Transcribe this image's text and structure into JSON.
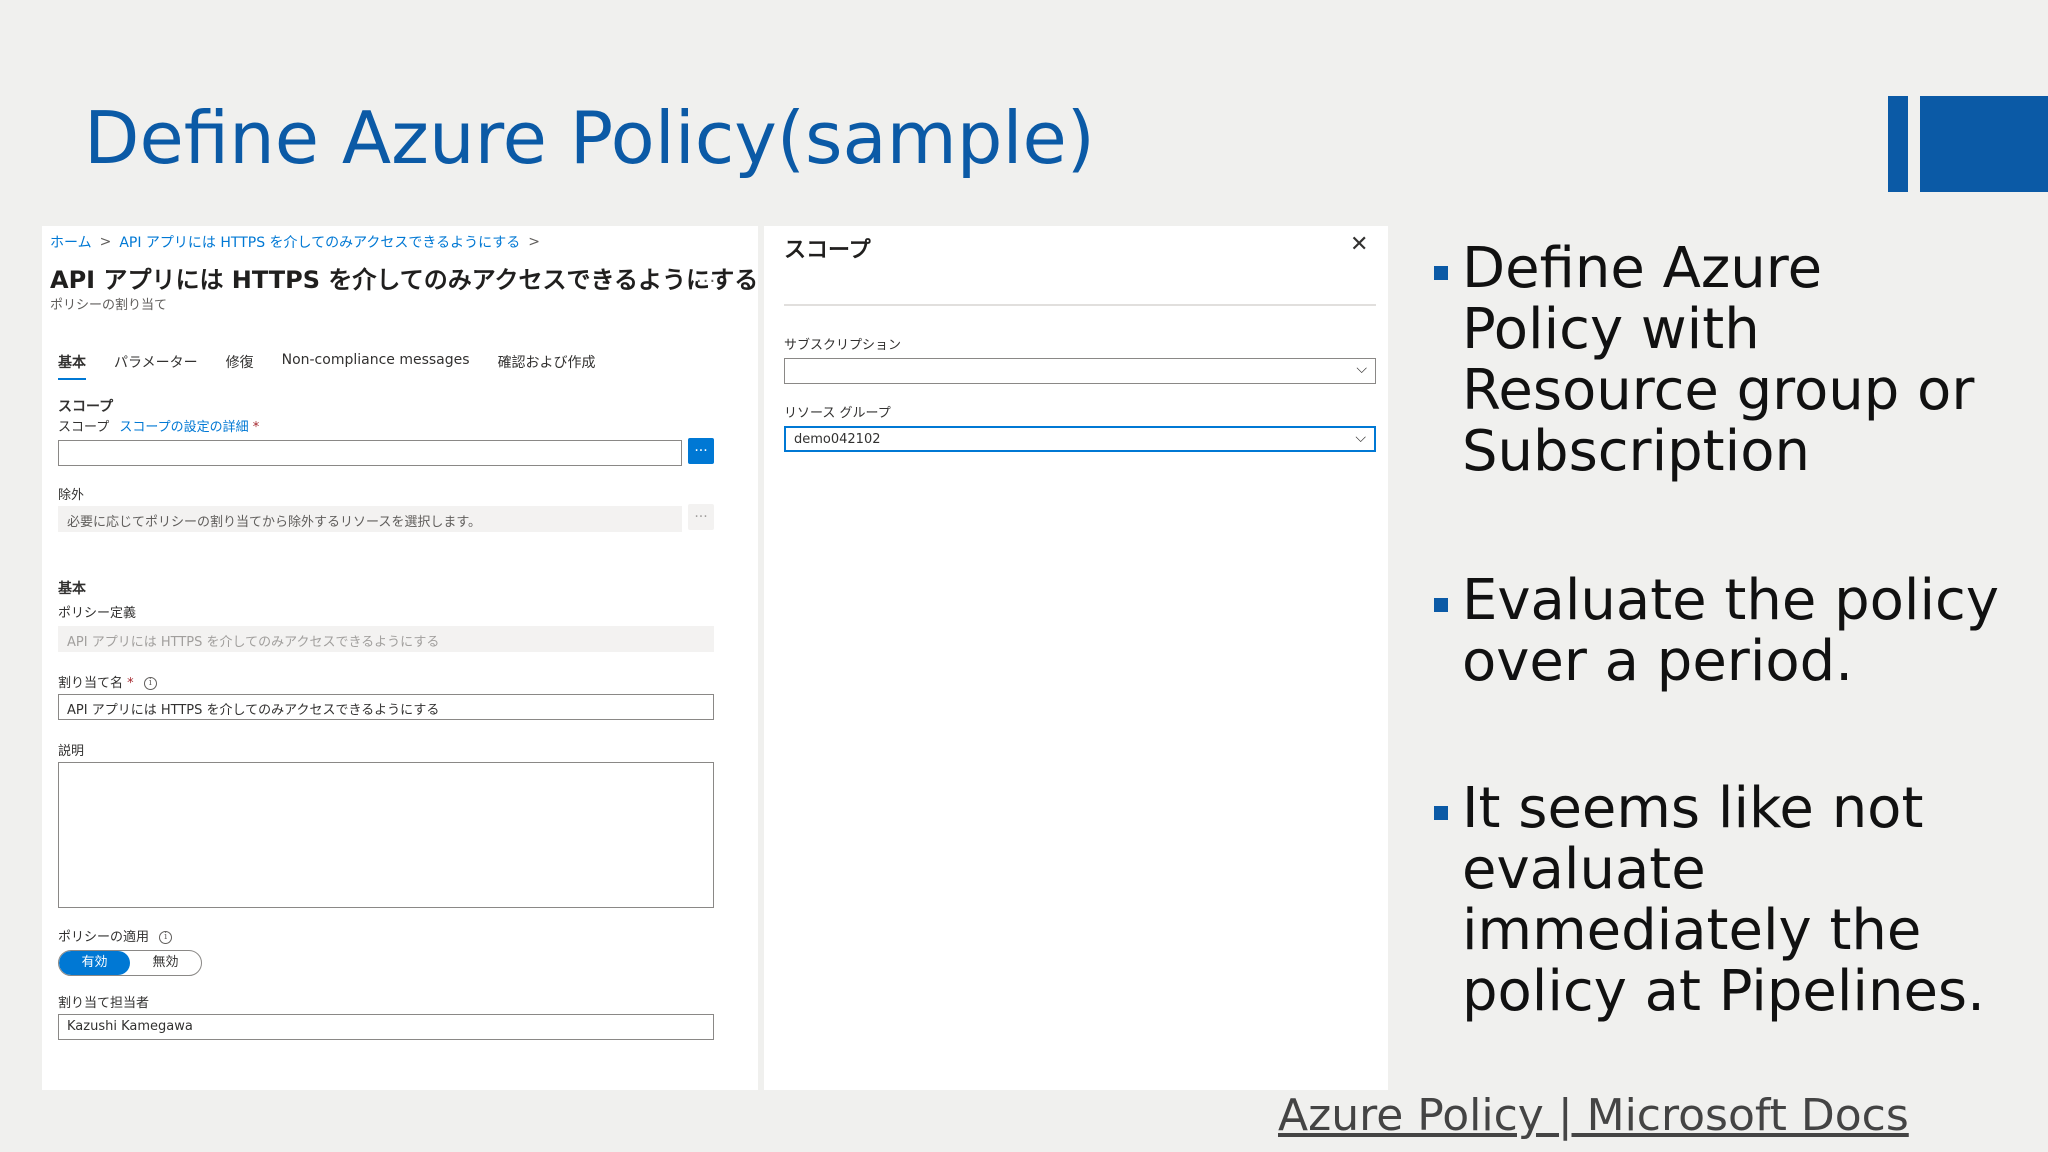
{
  "slide": {
    "title": "Define Azure Policy(sample)",
    "bullets": [
      [
        "Define Azure",
        "Policy with",
        "Resource group or",
        "Subscription"
      ],
      [
        "Evaluate the policy",
        "over a period."
      ],
      [
        "It seems like not",
        "evaluate",
        "immediately the",
        "policy at Pipelines."
      ]
    ],
    "footer_link": "Azure Policy | Microsoft Docs"
  },
  "blade": {
    "breadcrumb": [
      "ホーム",
      "API アプリには HTTPS を介してのみアクセスできるようにする"
    ],
    "title": "API アプリには HTTPS を介してのみアクセスできるようにする",
    "more": "...",
    "subtitle": "ポリシーの割り当て",
    "tabs": [
      "基本",
      "パラメーター",
      "修復",
      "Non-compliance messages",
      "確認および作成"
    ],
    "scope": {
      "section": "スコープ",
      "label": "スコープ",
      "link": "スコープの設定の詳細",
      "required": "*",
      "value": "",
      "browse": "..."
    },
    "exclusions": {
      "label": "除外",
      "placeholder": "必要に応じてポリシーの割り当てから除外するリソースを選択します。",
      "browse": "..."
    },
    "basics": {
      "section": "基本",
      "policy_def_label": "ポリシー定義",
      "policy_def_value": "API アプリには HTTPS を介してのみアクセスできるようにする",
      "assignment_name_label": "割り当て名",
      "assignment_name_required": "*",
      "assignment_name_value": "API アプリには HTTPS を介してのみアクセスできるようにする",
      "description_label": "説明",
      "enforcement_label": "ポリシーの適用",
      "enforcement_on": "有効",
      "enforcement_off": "無効",
      "assigned_by_label": "割り当て担当者",
      "assigned_by_value": "Kazushi Kamegawa"
    }
  },
  "scope_pane": {
    "title": "スコープ",
    "close": "✕",
    "subscription_label": "サブスクリプション",
    "subscription_value": "",
    "resource_group_label": "リソース グループ",
    "resource_group_value": "demo042102"
  },
  "colors": {
    "accent": "#0b5aa6",
    "azure_blue": "#0078d4",
    "background": "#f0f0ee"
  }
}
